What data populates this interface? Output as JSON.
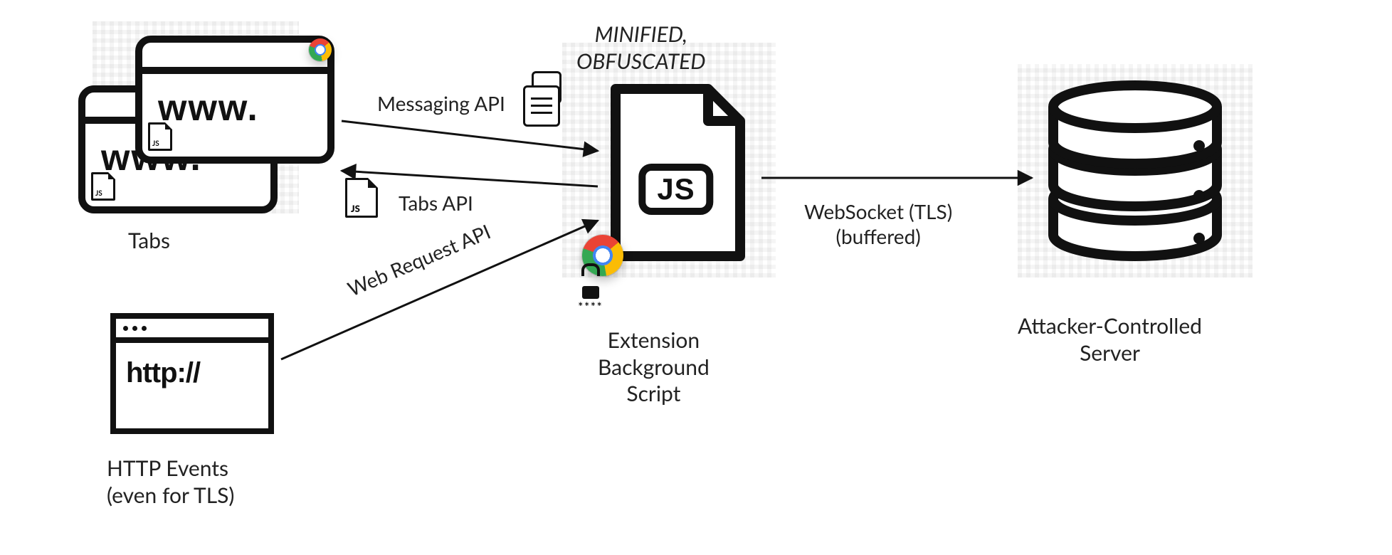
{
  "nodes": {
    "tabs": {
      "label": "Tabs",
      "window_text": "www."
    },
    "http": {
      "label": "HTTP Events\n(even for TLS)",
      "window_text": "http://"
    },
    "extension": {
      "header": "MINIFIED,\nOBFUSCATED",
      "label": "Extension\nBackground\nScript",
      "badge": "JS"
    },
    "server": {
      "label": "Attacker-Controlled\nServer"
    }
  },
  "edges": {
    "messaging": {
      "label": "Messaging API"
    },
    "tabs_api": {
      "label": "Tabs API"
    },
    "webrequest": {
      "label": "Web Request API"
    },
    "websocket": {
      "label": "WebSocket (TLS)\n(buffered)"
    }
  },
  "decorations": {
    "lock_stars": "****"
  }
}
